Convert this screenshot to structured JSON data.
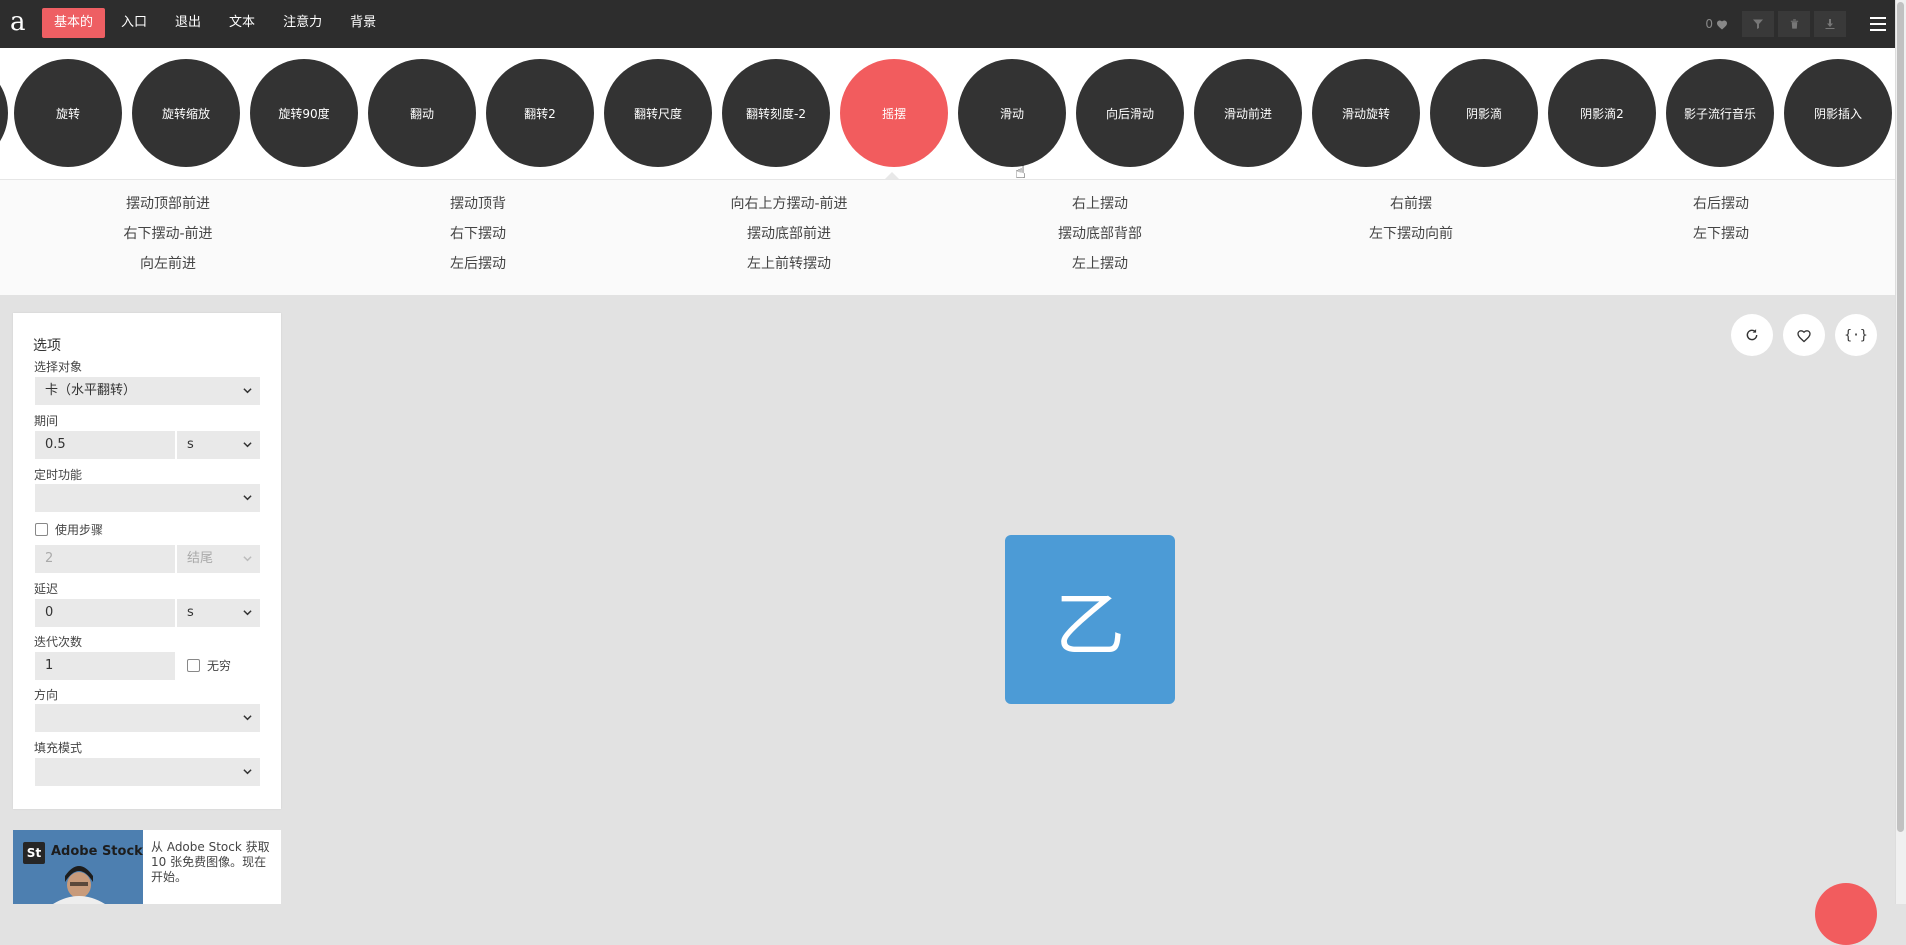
{
  "logo": "a",
  "menu": [
    "基本的",
    "入口",
    "退出",
    "文本",
    "注意力",
    "背景"
  ],
  "favorites_count": "0",
  "animations": [
    "旋转",
    "旋转缩放",
    "旋转90度",
    "翻动",
    "翻转2",
    "翻转尺度",
    "翻转刻度-2",
    "摇摆",
    "滑动",
    "向后滑动",
    "滑动前进",
    "滑动旋转",
    "阴影滴",
    "阴影滴2",
    "影子流行音乐",
    "阴影插入"
  ],
  "active_animation": "摇摆",
  "variants": [
    [
      "摆动顶部前进",
      "右下摆动-前进",
      "向左前进"
    ],
    [
      "摆动顶背",
      "右下摆动",
      "左后摆动"
    ],
    [
      "向右上方摆动-前进",
      "摆动底部前进",
      "左上前转摆动"
    ],
    [
      "右上摆动",
      "摆动底部背部",
      "左上摆动"
    ],
    [
      "右前摆",
      "左下摆动向前"
    ],
    [
      "右后摆动",
      "左下摆动"
    ]
  ],
  "options": {
    "title": "选项",
    "target_label": "选择对象",
    "target_value": "卡（水平翻转）",
    "duration_label": "期间",
    "duration_value": "0.5",
    "duration_unit": "s",
    "timing_label": "定时功能",
    "timing_value": "",
    "steps_label": "使用步骤",
    "steps_value": "2",
    "steps_mode": "结尾",
    "delay_label": "延迟",
    "delay_value": "0",
    "delay_unit": "s",
    "iterations_label": "迭代次数",
    "iterations_value": "1",
    "infinite_label": "无穷",
    "direction_label": "方向",
    "direction_value": "",
    "fill_label": "填充模式",
    "fill_value": ""
  },
  "ad": {
    "logo": "St",
    "brand": "Adobe Stock",
    "text": "从 Adobe Stock 获取 10 张免费图像。现在开始。"
  },
  "stage": {
    "card_letter": "乙",
    "code_button": "{·}"
  },
  "colors": {
    "accent": "#f25c5e",
    "card": "#4c9bd6",
    "dark": "#2d2d2d"
  }
}
